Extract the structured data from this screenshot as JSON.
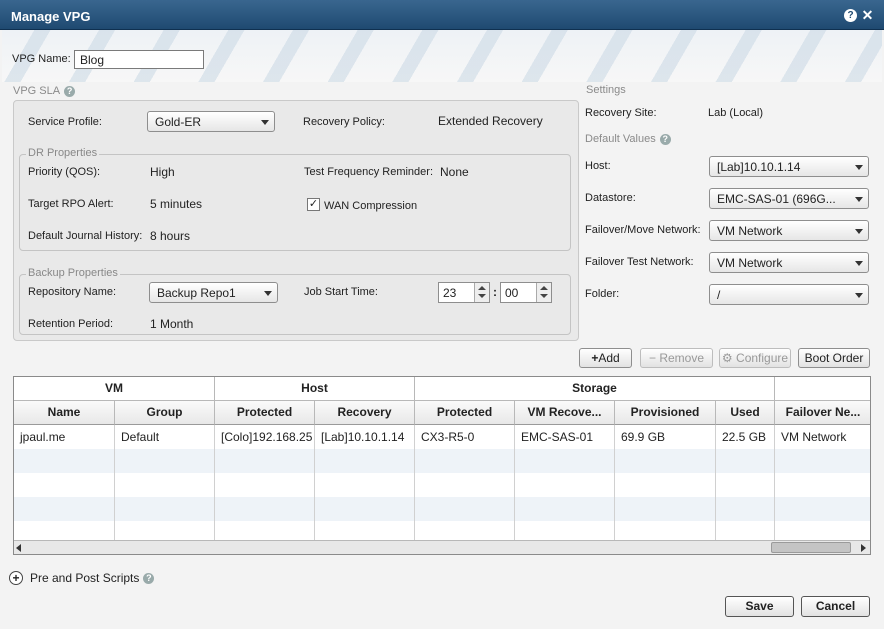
{
  "window": {
    "title": "Manage VPG"
  },
  "vpg_name": {
    "label": "VPG Name:",
    "value": "Blog"
  },
  "sla": {
    "title": "VPG SLA",
    "service_profile_label": "Service Profile:",
    "service_profile_value": "Gold-ER",
    "recovery_policy_label": "Recovery Policy:",
    "recovery_policy_value": "Extended Recovery",
    "dr": {
      "title": "DR Properties",
      "priority_label": "Priority (QOS):",
      "priority_value": "High",
      "test_freq_label": "Test Frequency Reminder:",
      "test_freq_value": "None",
      "rpo_label": "Target RPO Alert:",
      "rpo_value": "5 minutes",
      "wan_label": "WAN Compression",
      "wan_checked": "✓",
      "journal_label": "Default Journal History:",
      "journal_value": "8 hours"
    },
    "backup": {
      "title": "Backup Properties",
      "repo_label": "Repository Name:",
      "repo_value": "Backup Repo1",
      "job_start_label": "Job Start Time:",
      "hour": "23",
      "minute": "00",
      "sep": ":",
      "retention_label": "Retention Period:",
      "retention_value": "1 Month"
    }
  },
  "settings": {
    "title": "Settings",
    "recovery_site_label": "Recovery Site:",
    "recovery_site_value": "Lab (Local)",
    "defaults_title": "Default Values",
    "host_label": "Host:",
    "host_value": "[Lab]10.10.1.14",
    "datastore_label": "Datastore:",
    "datastore_value": "EMC-SAS-01 (696G...",
    "failover_label": "Failover/Move Network:",
    "failover_value": "VM Network",
    "test_net_label": "Failover Test Network:",
    "test_net_value": "VM Network",
    "folder_label": "Folder:",
    "folder_value": "/"
  },
  "toolbar": {
    "add": "Add",
    "remove": "Remove",
    "configure": "Configure",
    "boot_order": "Boot Order"
  },
  "grid": {
    "groups": [
      "VM",
      "Host",
      "Storage"
    ],
    "columns": [
      "Name",
      "Group",
      "Protected",
      "Recovery",
      "Protected",
      "VM Recove...",
      "Provisioned",
      "Used",
      "Failover Ne..."
    ],
    "rows": [
      [
        "jpaul.me",
        "Default",
        "[Colo]192.168.25",
        "[Lab]10.10.1.14",
        "CX3-R5-0",
        "EMC-SAS-01",
        "69.9 GB",
        "22.5 GB",
        "VM Network"
      ]
    ]
  },
  "scripts": {
    "label": "Pre and Post Scripts"
  },
  "footer": {
    "save": "Save",
    "cancel": "Cancel"
  },
  "colors": {
    "title_bar": "#1f4a71",
    "row_alt": "#eef3f8"
  }
}
